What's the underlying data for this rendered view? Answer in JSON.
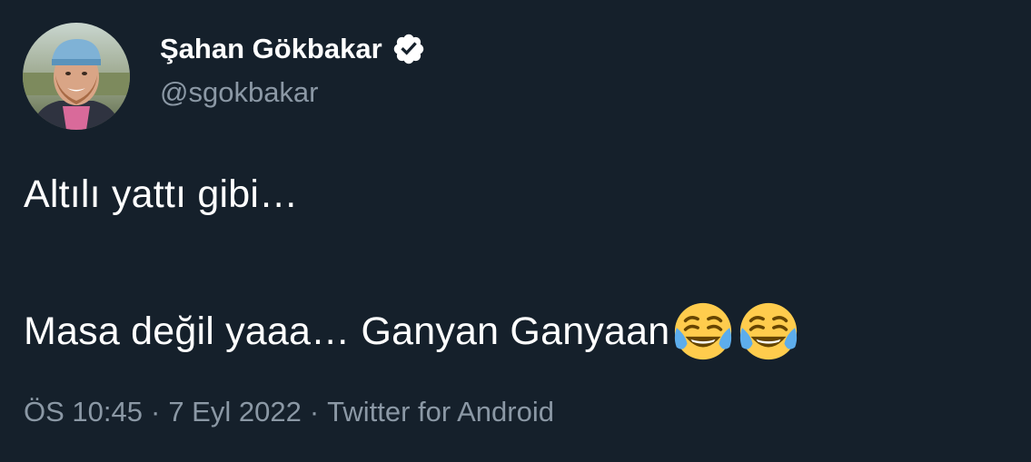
{
  "author": {
    "display_name": "Şahan Gökbakar",
    "handle": "@sgokbakar",
    "verified_icon": "verified-badge-icon",
    "avatar_icon": "profile-avatar"
  },
  "tweet": {
    "line1": "Altılı yattı gibi…",
    "line2": "Masa değil yaaa… Ganyan Ganyaan",
    "line2_emojis": [
      "face-with-tears-of-joy-emoji",
      "face-with-tears-of-joy-emoji"
    ]
  },
  "meta": {
    "time": "ÖS 10:45",
    "separator": "·",
    "date": "7 Eyl 2022",
    "source": "Twitter for Android"
  },
  "colors": {
    "background": "#15202b",
    "primary_text": "#ffffff",
    "secondary_text": "#8b98a5"
  }
}
